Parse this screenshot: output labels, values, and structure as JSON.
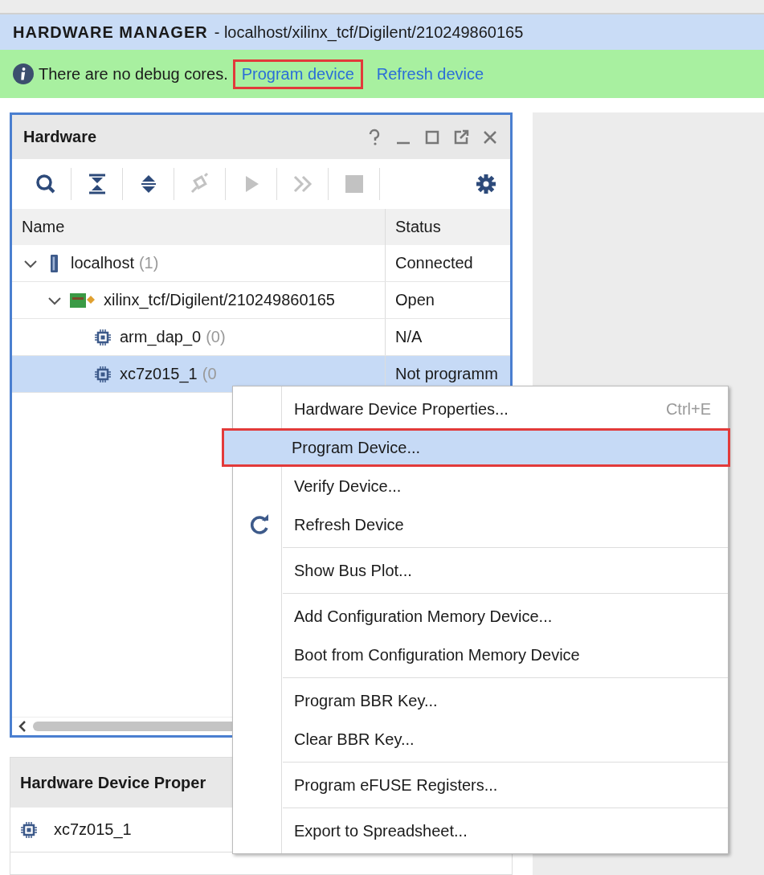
{
  "header": {
    "title": "HARDWARE MANAGER",
    "subtitle": "- localhost/xilinx_tcf/Digilent/210249860165"
  },
  "banner": {
    "message": "There are no debug cores.",
    "links": [
      {
        "label": "Program device",
        "highlighted": true
      },
      {
        "label": "Refresh device",
        "highlighted": false
      }
    ]
  },
  "hardware_panel": {
    "title": "Hardware",
    "toolbar": [
      {
        "kind": "search",
        "disabled": false
      },
      {
        "kind": "collapse",
        "disabled": false
      },
      {
        "kind": "expand",
        "disabled": false
      },
      {
        "kind": "connect",
        "disabled": true
      },
      {
        "kind": "run",
        "disabled": true
      },
      {
        "kind": "forward",
        "disabled": true
      },
      {
        "kind": "stop",
        "disabled": true
      },
      {
        "kind": "settings",
        "disabled": false
      }
    ],
    "columns": [
      "Name",
      "Status"
    ],
    "tree": [
      {
        "kind": "host",
        "name": "localhost",
        "count": "(1)",
        "status": "Connected",
        "expanded": true,
        "selected": false,
        "children": [
          {
            "kind": "cable",
            "name": "xilinx_tcf/Digilent/210249860165",
            "status": "Open",
            "expanded": true,
            "selected": false,
            "children": [
              {
                "kind": "chip",
                "name": "arm_dap_0",
                "count": "(0)",
                "status": "N/A",
                "selected": false
              },
              {
                "kind": "chip",
                "name": "xc7z015_1",
                "count": "(0",
                "status": "Not programm",
                "selected": true
              }
            ]
          }
        ]
      }
    ]
  },
  "properties_panel": {
    "title": "Hardware Device Proper",
    "item": "xc7z015_1"
  },
  "context_menu": {
    "groups": [
      [
        {
          "label": "Hardware Device Properties...",
          "shortcut": "Ctrl+E",
          "selected": false,
          "highlighted": false
        },
        {
          "label": "Program Device...",
          "selected": true,
          "highlighted": true
        },
        {
          "label": "Verify Device...",
          "selected": false,
          "highlighted": false
        },
        {
          "label": "Refresh Device",
          "kind": "refresh",
          "selected": false,
          "highlighted": false
        }
      ],
      [
        {
          "label": "Show Bus Plot...",
          "selected": false,
          "highlighted": false
        }
      ],
      [
        {
          "label": "Add Configuration Memory Device...",
          "selected": false,
          "highlighted": false
        },
        {
          "label": "Boot from Configuration Memory Device",
          "selected": false,
          "highlighted": false
        }
      ],
      [
        {
          "label": "Program BBR Key...",
          "selected": false,
          "highlighted": false
        },
        {
          "label": "Clear BBR Key...",
          "selected": false,
          "highlighted": false
        }
      ],
      [
        {
          "label": "Program eFUSE Registers...",
          "selected": false,
          "highlighted": false
        }
      ],
      [
        {
          "label": "Export to Spreadsheet...",
          "selected": false,
          "highlighted": false
        }
      ]
    ]
  }
}
